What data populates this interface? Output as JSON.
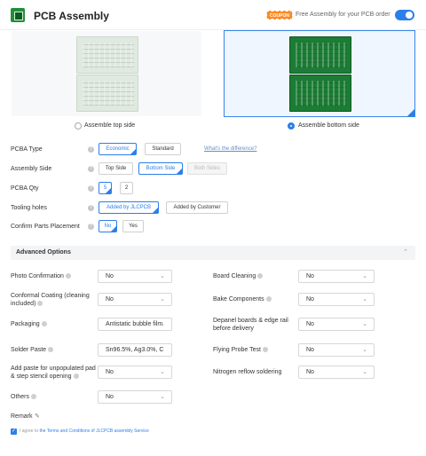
{
  "header": {
    "title": "PCB Assembly",
    "coupon": "COUPON",
    "free_text": "Free Assembly for your PCB order"
  },
  "side": {
    "top_label": "Assemble top side",
    "bottom_label": "Assemble bottom side"
  },
  "rows": {
    "type": {
      "label": "PCBA Type",
      "economic": "Economic",
      "standard": "Standard",
      "diff": "What's the difference?"
    },
    "assembly_side": {
      "label": "Assembly Side",
      "top": "Top Side",
      "bottom": "Bottom Side",
      "both": "Both Sides"
    },
    "qty": {
      "label": "PCBA Qty",
      "v1": "5",
      "v2": "2"
    },
    "tooling": {
      "label": "Tooling holes",
      "jlc": "Added by JLCPCB",
      "customer": "Added by Customer"
    },
    "confirm": {
      "label": "Confirm Parts Placement",
      "no": "No",
      "yes": "Yes"
    }
  },
  "advanced": {
    "title": "Advanced Options"
  },
  "options": {
    "photo": {
      "label": "Photo Confirmation",
      "value": "No"
    },
    "conformal": {
      "label": "Conformal Coating (cleaning included)",
      "value": "No"
    },
    "packaging": {
      "label": "Packaging",
      "value": "Antistatic bubble film"
    },
    "solder": {
      "label": "Solder Paste",
      "value": "Sn96.5%, Ag3.0%, C"
    },
    "paste": {
      "label": "Add paste for unpopulated pad & step stencil opening",
      "value": "No"
    },
    "others": {
      "label": "Others",
      "value": "No"
    },
    "board_clean": {
      "label": "Board Cleaning",
      "value": "No"
    },
    "bake": {
      "label": "Bake Components",
      "value": "No"
    },
    "depanel": {
      "label": "Depanel boards & edge rail before delivery",
      "value": "No"
    },
    "flying": {
      "label": "Flying Probe Test",
      "value": "No"
    },
    "nitrogen": {
      "label": "Nitrogen reflow soldering",
      "value": "No"
    }
  },
  "footer": {
    "remark": "Remark",
    "agree_prefix": "I agree to",
    "terms": "the Terms and Conditions of JLCPCB assembly Service"
  }
}
